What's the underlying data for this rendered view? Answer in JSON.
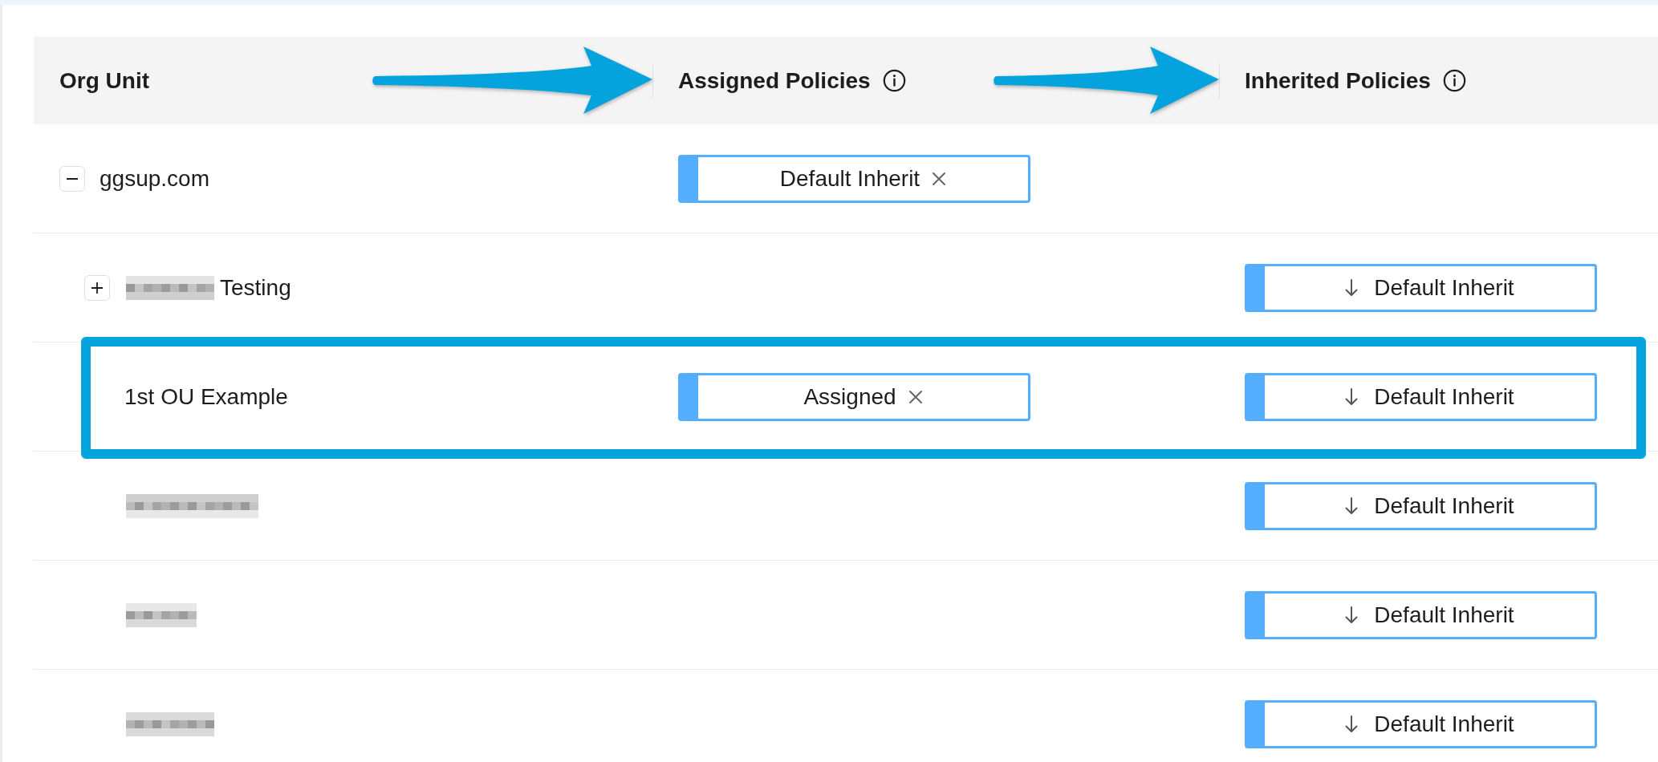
{
  "table": {
    "columns": [
      {
        "label": "Org Unit",
        "info": false,
        "arrow": false
      },
      {
        "label": "Assigned Policies",
        "info": true,
        "arrow": true
      },
      {
        "label": "Inherited Policies",
        "info": true,
        "arrow": true
      }
    ],
    "rows": [
      {
        "name": "ggsup.com",
        "redacted": false,
        "expanded": true,
        "highlighted": false,
        "assigned_policy": "Default Inherit",
        "children": [
          {
            "name": "Testing",
            "redacted": true,
            "expanded": false,
            "highlighted": false,
            "inherited_policy": "Default Inherit"
          },
          {
            "name": "1st OU Example",
            "redacted": false,
            "highlighted": true,
            "assigned_policy": "Assigned",
            "inherited_policy": "Default Inherit"
          },
          {
            "redacted": true,
            "highlighted": false,
            "inherited_policy": "Default Inherit"
          },
          {
            "redacted": true,
            "highlighted": false,
            "inherited_policy": "Default Inherit"
          },
          {
            "redacted": true,
            "highlighted": false,
            "inherited_policy": "Default Inherit"
          }
        ]
      }
    ]
  }
}
